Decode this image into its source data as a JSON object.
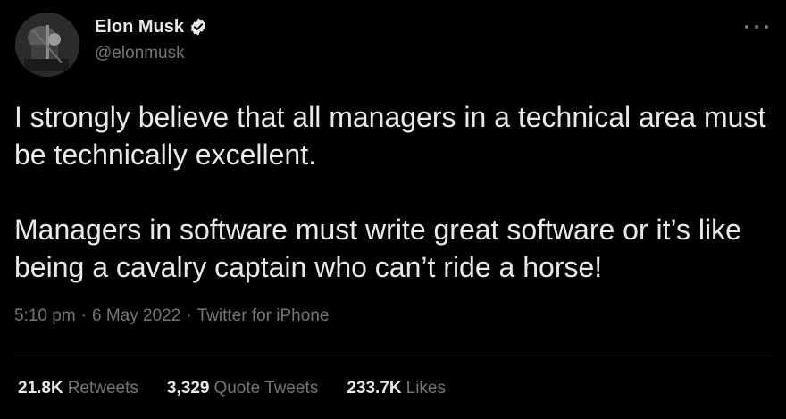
{
  "author": {
    "display_name": "Elon Musk",
    "handle": "@elonmusk",
    "verified": true,
    "avatar_icon": "profile-photo"
  },
  "tweet": {
    "paragraphs": [
      "I strongly believe that all managers in a technical area must be technically excellent.",
      "Managers in software must write great software or it’s like being a cavalry captain who can’t ride a horse!"
    ],
    "time": "5:10 pm",
    "date": "6 May 2022",
    "source": "Twitter for iPhone",
    "separator": "·"
  },
  "stats": {
    "retweets": {
      "value": "21.8K",
      "label": "Retweets"
    },
    "quote_tweets": {
      "value": "3,329",
      "label": "Quote Tweets"
    },
    "likes": {
      "value": "233.7K",
      "label": "Likes"
    }
  },
  "colors": {
    "background": "#000000",
    "text_primary": "#e7e9ea",
    "text_secondary": "#71767b",
    "divider": "#2f3336",
    "verified_badge": "#e7e9ea"
  }
}
